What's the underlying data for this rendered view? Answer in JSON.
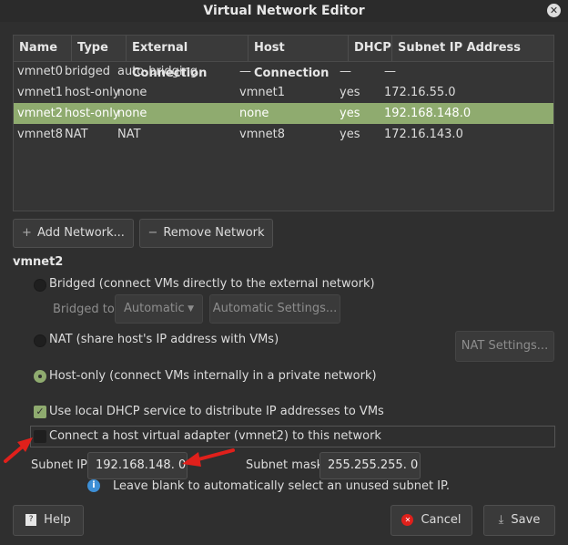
{
  "window": {
    "title": "Virtual Network Editor",
    "close_icon": "close-icon"
  },
  "table": {
    "columns": [
      "Name",
      "Type",
      "External Connection",
      "Host Connection",
      "DHCP",
      "Subnet IP Address"
    ],
    "rows": [
      [
        "vmnet0",
        "bridged",
        "auto-bridging",
        "—",
        "—",
        "—"
      ],
      [
        "vmnet1",
        "host-only",
        "none",
        "vmnet1",
        "yes",
        "172.16.55.0"
      ],
      [
        "vmnet2",
        "host-only",
        "none",
        "none",
        "yes",
        "192.168.148.0"
      ],
      [
        "vmnet8",
        "NAT",
        "NAT",
        "vmnet8",
        "yes",
        "172.16.143.0"
      ]
    ],
    "selected_row": 2
  },
  "buttons": {
    "add_network": "Add Network...",
    "remove_network": "Remove Network",
    "automatic_settings": "Automatic Settings...",
    "nat_settings": "NAT Settings...",
    "help": "Help",
    "cancel": "Cancel",
    "save": "Save"
  },
  "settings": {
    "section_title": "vmnet2",
    "bridged_label": "Bridged (connect VMs directly to the external network)",
    "bridged_to_label": "Bridged to:",
    "bridged_to_value": "Automatic",
    "nat_label": "NAT (share host's IP address with VMs)",
    "host_only_label": "Host-only (connect VMs internally in a private network)",
    "dhcp_label": "Use local DHCP service to distribute IP addresses to VMs",
    "host_adapter_label": "Connect a host virtual adapter (vmnet2) to this network",
    "subnet_ip_label": "Subnet IP:",
    "subnet_ip_value": "192.168.148.  0",
    "subnet_mask_label": "Subnet mask:",
    "subnet_mask_value": "255.255.255.  0",
    "info_text": "Leave blank to automatically select an unused subnet IP."
  },
  "colors": {
    "selection": "#8fab6f",
    "arrow": "#e0201b",
    "info": "#3d8fd6"
  }
}
